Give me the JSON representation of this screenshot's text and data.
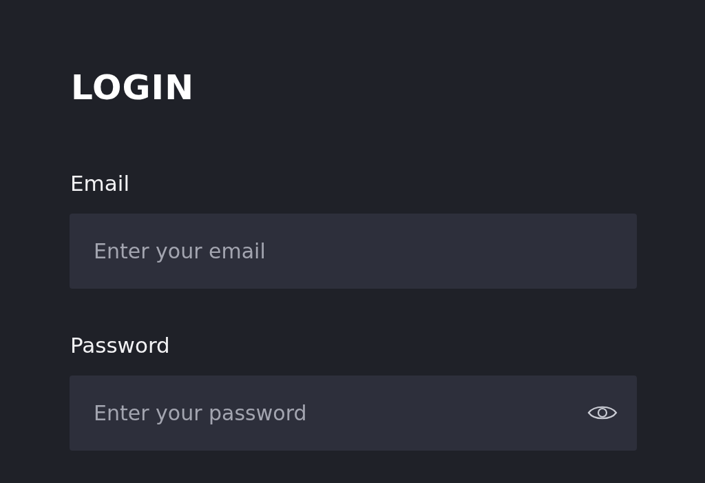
{
  "title": "LOGIN",
  "fields": [
    {
      "label": "Email",
      "placeholder": "Enter your email",
      "kind": "email"
    },
    {
      "label": "Password",
      "placeholder": "Enter your password",
      "kind": "password"
    }
  ]
}
